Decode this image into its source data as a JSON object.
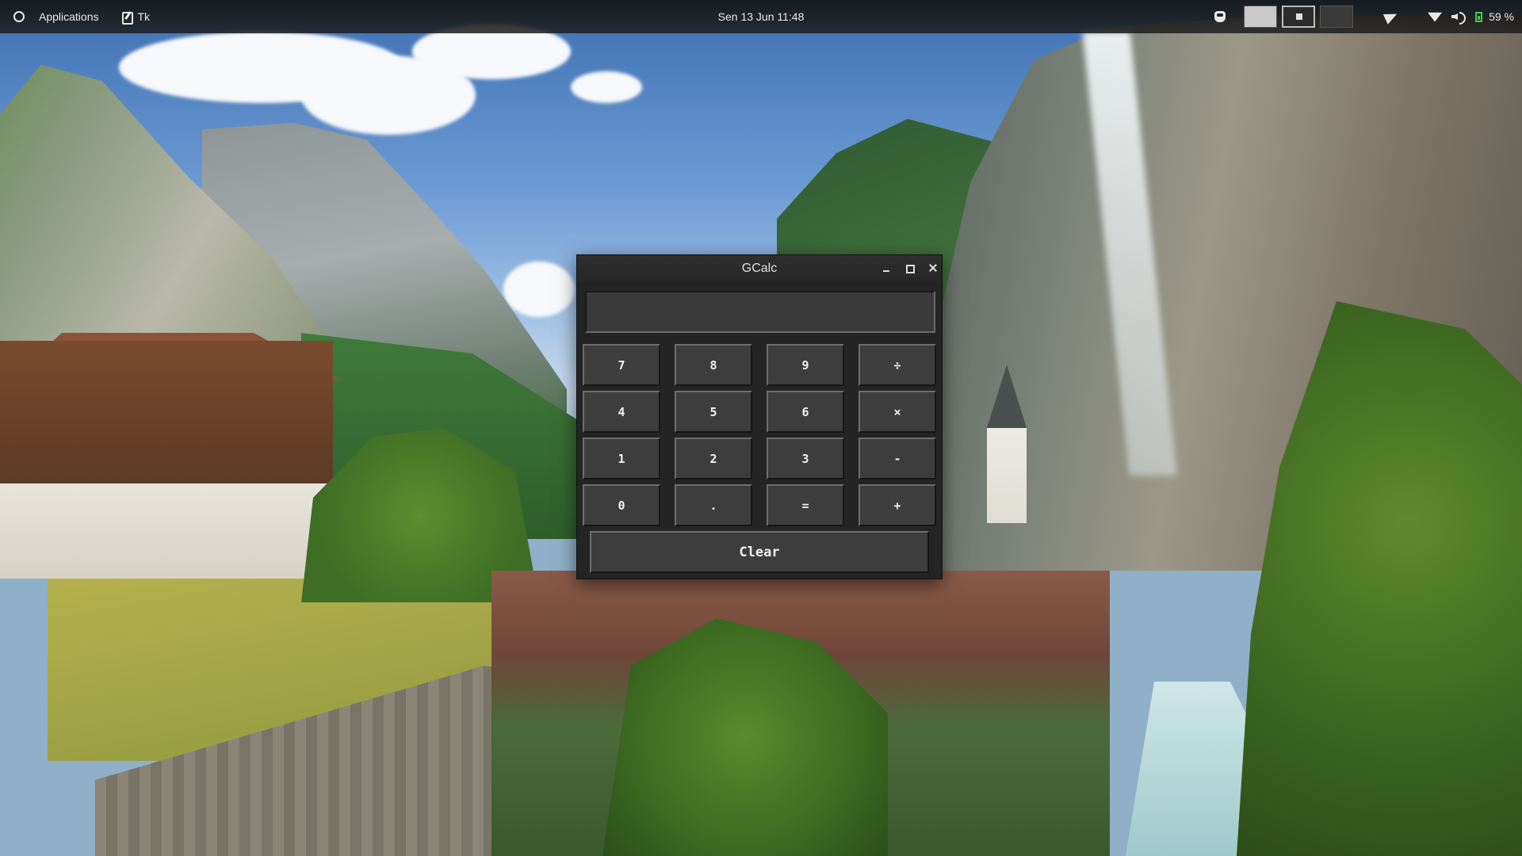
{
  "topbar": {
    "applications_label": "Applications",
    "task_label": "Tk",
    "datetime": "Sen 13 Jun  11:48",
    "battery_text": "59 %",
    "icons": [
      "app-menu-icon",
      "tk-app-icon",
      "hand-icon",
      "send-icon",
      "wifi-icon",
      "volume-icon",
      "battery-icon"
    ],
    "workspaces": [
      "1",
      "2",
      "3"
    ],
    "active_workspace": 2
  },
  "window": {
    "title": "GCalc",
    "display_value": ""
  },
  "keypad": {
    "rows": [
      [
        "7",
        "8",
        "9",
        "÷"
      ],
      [
        "4",
        "5",
        "6",
        "×"
      ],
      [
        "1",
        "2",
        "3",
        "-"
      ],
      [
        "0",
        ".",
        "=",
        "+"
      ]
    ],
    "clear_label": "Clear"
  },
  "colors": {
    "panel_bg": "#1a1a1a",
    "window_bg": "#242424",
    "key_bg": "#3d3d3d",
    "battery_accent": "#3fcf4a"
  }
}
